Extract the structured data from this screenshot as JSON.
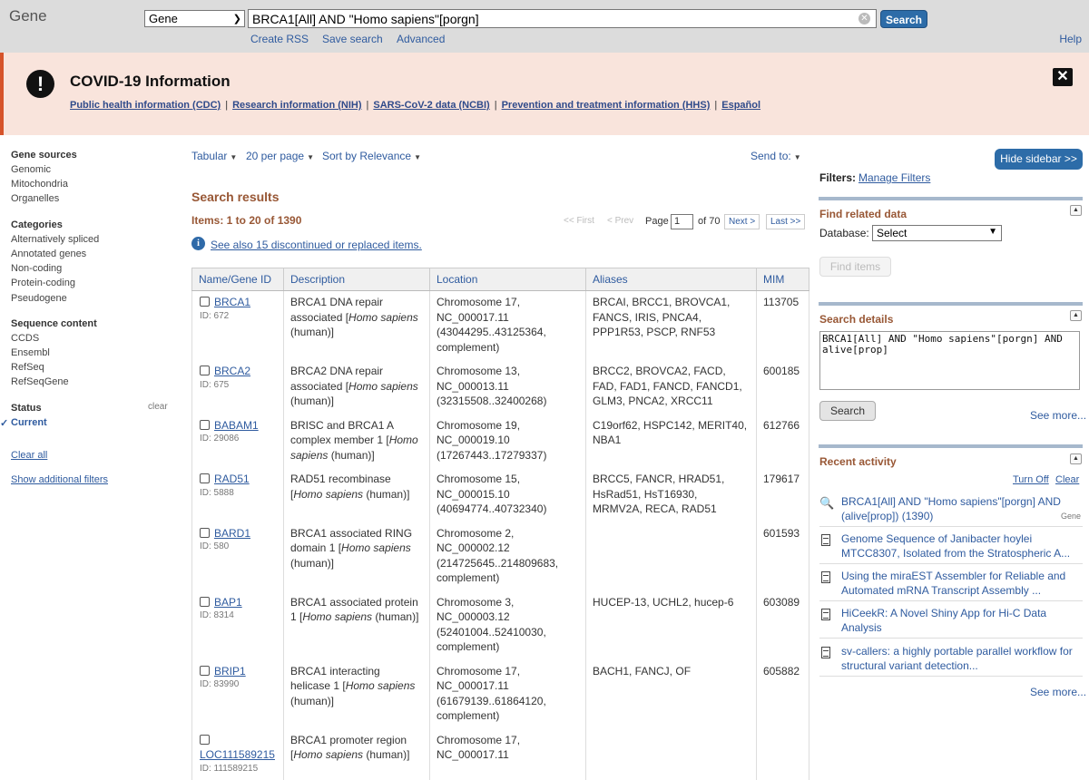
{
  "header": {
    "app_label": "Gene",
    "db_selected": "Gene",
    "query": "BRCA1[All] AND \"Homo sapiens\"[porgn]",
    "search_button": "Search",
    "links": [
      "Create RSS",
      "Save search",
      "Advanced"
    ],
    "help": "Help"
  },
  "covid": {
    "title": "COVID-19 Information",
    "links": [
      "Public health information (CDC)",
      "Research information (NIH)",
      "SARS-CoV-2 data (NCBI)",
      "Prevention and treatment information (HHS)",
      "Español"
    ],
    "separator": "|"
  },
  "left_filters": {
    "gene_sources": {
      "title": "Gene sources",
      "items": [
        "Genomic",
        "Mitochondria",
        "Organelles"
      ]
    },
    "categories": {
      "title": "Categories",
      "items": [
        "Alternatively spliced",
        "Annotated genes",
        "Non-coding",
        "Protein-coding",
        "Pseudogene"
      ]
    },
    "sequence_content": {
      "title": "Sequence content",
      "items": [
        "CCDS",
        "Ensembl",
        "RefSeq",
        "RefSeqGene"
      ]
    },
    "status": {
      "title": "Status",
      "clear": "clear",
      "current": "Current"
    },
    "clear_all": "Clear all",
    "show_additional": "Show additional filters"
  },
  "controls": {
    "format": "Tabular",
    "per_page": "20 per page",
    "sort": "Sort by Relevance",
    "send_to": "Send to:"
  },
  "results": {
    "title": "Search results",
    "items": "Items: 1 to 20 of 1390",
    "pager": {
      "first": "<< First",
      "prev": "< Prev",
      "page_label": "Page",
      "page_value": "1",
      "of": "of 70",
      "next": "Next >",
      "last": "Last >>"
    },
    "see_also": "See also 15 discontinued or replaced items.",
    "columns": [
      "Name/Gene ID",
      "Description",
      "Location",
      "Aliases",
      "MIM"
    ],
    "rows": [
      {
        "symbol": "BRCA1",
        "id": "ID: 672",
        "desc_a": "BRCA1 DNA repair associated [",
        "desc_i": "Homo sapiens",
        "desc_b": " (human)]",
        "location": "Chromosome 17, NC_000017.11 (43044295..43125364, complement)",
        "aliases": "BRCAI, BRCC1, BROVCA1, FANCS, IRIS, PNCA4, PPP1R53, PSCP, RNF53",
        "mim": "113705"
      },
      {
        "symbol": "BRCA2",
        "id": "ID: 675",
        "desc_a": "BRCA2 DNA repair associated [",
        "desc_i": "Homo sapiens",
        "desc_b": " (human)]",
        "location": "Chromosome 13, NC_000013.11 (32315508..32400268)",
        "aliases": "BRCC2, BROVCA2, FACD, FAD, FAD1, FANCD, FANCD1, GLM3, PNCA2, XRCC11",
        "mim": "600185"
      },
      {
        "symbol": "BABAM1",
        "id": "ID: 29086",
        "desc_a": "BRISC and BRCA1 A complex member 1 [",
        "desc_i": "Homo sapiens",
        "desc_b": " (human)]",
        "location": "Chromosome 19, NC_000019.10 (17267443..17279337)",
        "aliases": "C19orf62, HSPC142, MERIT40, NBA1",
        "mim": "612766"
      },
      {
        "symbol": "RAD51",
        "id": "ID: 5888",
        "desc_a": "RAD51 recombinase [",
        "desc_i": "Homo sapiens",
        "desc_b": " (human)]",
        "location": "Chromosome 15, NC_000015.10 (40694774..40732340)",
        "aliases": "BRCC5, FANCR, HRAD51, HsRad51, HsT16930, MRMV2A, RECA, RAD51",
        "mim": "179617"
      },
      {
        "symbol": "BARD1",
        "id": "ID: 580",
        "desc_a": "BRCA1 associated RING domain 1 [",
        "desc_i": "Homo sapiens",
        "desc_b": " (human)]",
        "location": "Chromosome 2, NC_000002.12 (214725645..214809683, complement)",
        "aliases": "",
        "mim": "601593"
      },
      {
        "symbol": "BAP1",
        "id": "ID: 8314",
        "desc_a": "BRCA1 associated protein 1 [",
        "desc_i": "Homo sapiens",
        "desc_b": " (human)]",
        "location": "Chromosome 3, NC_000003.12 (52401004..52410030, complement)",
        "aliases": "HUCEP-13, UCHL2, hucep-6",
        "mim": "603089"
      },
      {
        "symbol": "BRIP1",
        "id": "ID: 83990",
        "desc_a": "BRCA1 interacting helicase 1 [",
        "desc_i": "Homo sapiens",
        "desc_b": " (human)]",
        "location": "Chromosome 17, NC_000017.11 (61679139..61864120, complement)",
        "aliases": "BACH1, FANCJ, OF",
        "mim": "605882"
      },
      {
        "symbol": "LOC111589215",
        "id": "ID: 111589215",
        "desc_a": "BRCA1 promoter region [",
        "desc_i": "Homo sapiens",
        "desc_b": " (human)]",
        "location": "Chromosome 17, NC_000017.11",
        "aliases": "",
        "mim": ""
      }
    ]
  },
  "sidebar": {
    "hide_button": "Hide sidebar >>",
    "filters_label": "Filters:",
    "manage_filters": "Manage Filters",
    "find_related": {
      "title": "Find related data",
      "db_label": "Database:",
      "db_value": "Select",
      "find_items": "Find items"
    },
    "search_details": {
      "title": "Search details",
      "query": "BRCA1[All] AND \"Homo sapiens\"[porgn] AND alive[prop]",
      "search_button": "Search",
      "see_more": "See more..."
    },
    "recent_activity": {
      "title": "Recent activity",
      "turn_off": "Turn Off",
      "clear": "Clear",
      "items": [
        {
          "icon": "search-icon",
          "text": "BRCA1[All] AND \"Homo sapiens\"[porgn] AND (alive[prop]) (1390)",
          "db": "Gene"
        },
        {
          "icon": "document-icon",
          "text": "Genome Sequence of Janibacter hoylei MTCC8307, Isolated from the Stratospheric A..."
        },
        {
          "icon": "document-icon",
          "text": "Using the miraEST Assembler for Reliable and Automated mRNA Transcript Assembly ..."
        },
        {
          "icon": "document-icon",
          "text": "HiCeekR: A Novel Shiny App for Hi-C Data Analysis"
        },
        {
          "icon": "document-icon",
          "text": "sv-callers: a highly portable parallel workflow for structural variant detection..."
        }
      ],
      "see_more": "See more..."
    }
  }
}
